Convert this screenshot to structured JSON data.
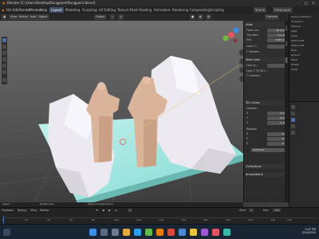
{
  "window": {
    "title": "Blender [C:\\Users\\Desktop\\Rungpoint\\Rungpoint.blend]",
    "minimize": "–",
    "maximize": "□",
    "close": "✕"
  },
  "menu": {
    "items": [
      "File",
      "Edit",
      "Render",
      "Window",
      "Help"
    ],
    "workspaces": [
      "Layout",
      "Modeling",
      "Sculpting",
      "UV Editing",
      "Texture Paint",
      "Shading",
      "Animation",
      "Rendering",
      "Compositing",
      "Scripting"
    ],
    "active_workspace": "Layout",
    "scene_label": "Scene",
    "view_layer_label": "ViewLayer"
  },
  "viewport_header": {
    "mode": "Object Mode",
    "view": "View",
    "select": "Select",
    "add": "Add",
    "object": "Object",
    "transform": "Global",
    "options": "Options"
  },
  "npanel": {
    "view_section": "View",
    "focal_length_label": "Focal Len...",
    "focal_length_value": "50 mm",
    "clip_start_label": "Clip Start",
    "clip_start_value": "0.1 m",
    "end_label": "End",
    "end_value": "1000 m",
    "local_camera_label": "Local C...",
    "render_region_label": "Render...",
    "view_lock_section": "View Lock",
    "lock_to_object_label": "Lock to...",
    "lock_label": "Lock",
    "to_3d_cursor": "To 3D C...",
    "camera_to_view": "Camera...",
    "cursor_section": "3D Cursor",
    "location_label": "Location",
    "x_label": "X",
    "y_label": "Y",
    "z_label": "Z",
    "x_value": "0 m",
    "y_value": "0 m",
    "z_value": "0 m",
    "rotation_label": "Rotation",
    "rx_value": "0°",
    "ry_value": "0°",
    "rz_value": "0°",
    "rotation_mode": "XYZ Euler",
    "collections_section": "Collections",
    "annotations_section": "Annotations",
    "tabs": [
      "Item",
      "Tool",
      "View"
    ]
  },
  "outliner": {
    "rows": [
      "Scene Collection",
      "Collection",
      "Camera",
      "Light",
      "Cube",
      "Statue.001",
      "Statue.002",
      "Rock",
      "Ground",
      "Plane",
      "Empty",
      "Lamp"
    ]
  },
  "timeline": {
    "playback": "Playback",
    "keying": "Keying",
    "view": "View",
    "marker": "Marker",
    "current_frame": "1",
    "start_label": "Start",
    "start_value": "1",
    "end_label": "End",
    "end_value": "250",
    "ticks": [
      "0",
      "20",
      "40",
      "60",
      "80",
      "100",
      "120",
      "140",
      "160",
      "180",
      "200",
      "220",
      "240",
      "250"
    ]
  },
  "status_bar": {
    "left": "Select",
    "middle": "Rotate View",
    "right": "Object Context Menu"
  },
  "taskbar": {
    "time": "2:47 PM",
    "date": "3/14/2024"
  },
  "colors": {
    "accent": "#4772b3",
    "ground": "#9fe6e0",
    "rock": "#e8e6ec",
    "statue": "#d9b39a"
  }
}
